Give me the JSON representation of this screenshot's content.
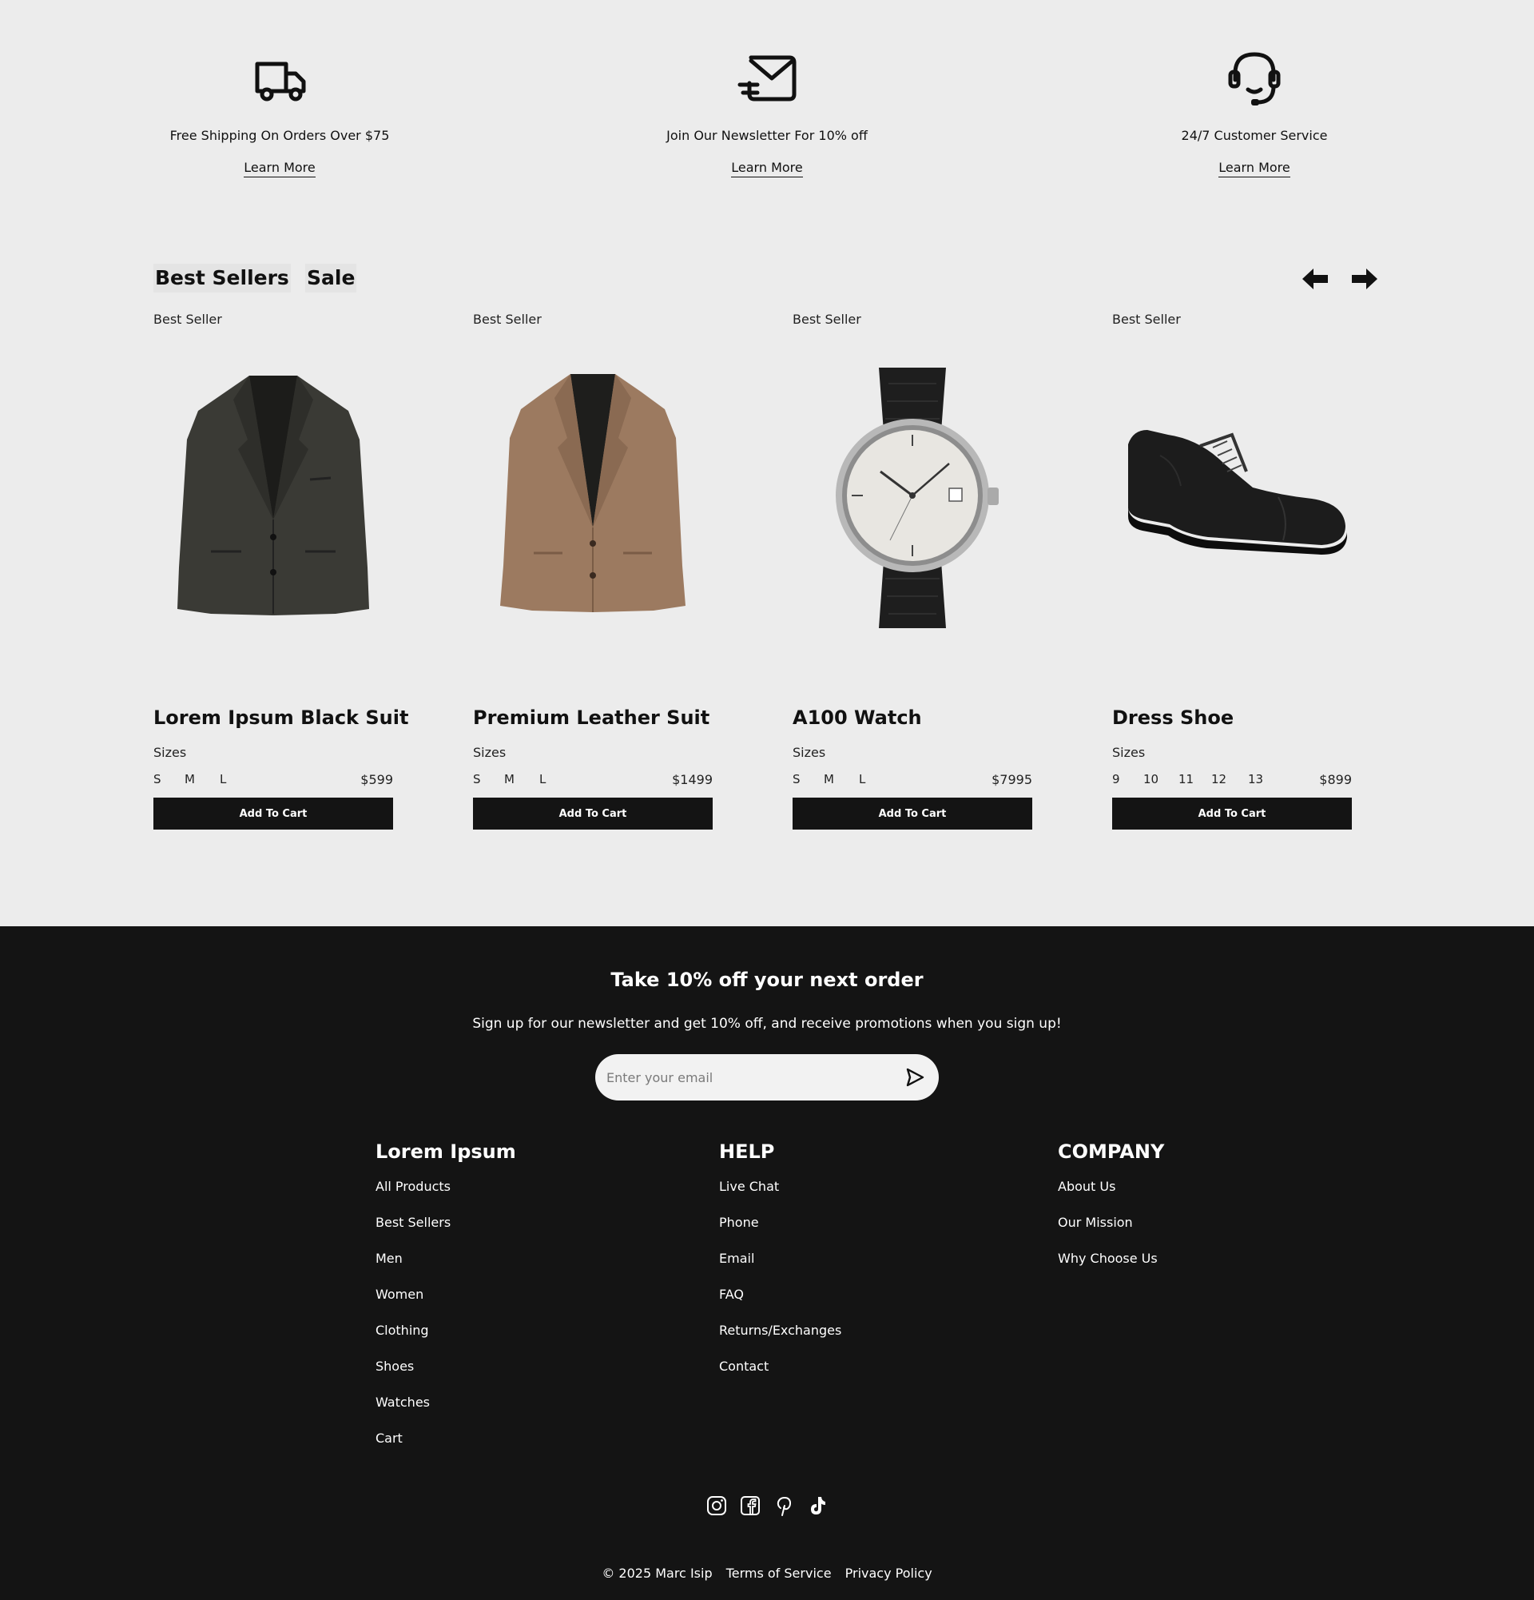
{
  "features": [
    {
      "icon": "truck-icon",
      "text": "Free Shipping On Orders Over $75",
      "link": "Learn More"
    },
    {
      "icon": "mail-icon",
      "text": "Join Our Newsletter For 10% off",
      "link": "Learn More"
    },
    {
      "icon": "headset-icon",
      "text": "24/7 Customer Service",
      "link": "Learn More"
    }
  ],
  "products_section": {
    "tabs": [
      "Best Sellers",
      "Sale"
    ],
    "prev_icon": "arrow-left-icon",
    "next_icon": "arrow-right-icon"
  },
  "products": [
    {
      "badge": "Best Seller",
      "image": "black-suit",
      "name": "Lorem Ipsum Black Suit",
      "sizes_label": "Sizes",
      "sizes": [
        "S",
        "M",
        "L"
      ],
      "price": "$599",
      "button": "Add To Cart"
    },
    {
      "badge": "Best Seller",
      "image": "tan-suit",
      "name": "Premium Leather Suit",
      "sizes_label": "Sizes",
      "sizes": [
        "S",
        "M",
        "L"
      ],
      "price": "$1499",
      "button": "Add To Cart"
    },
    {
      "badge": "Best Seller",
      "image": "watch",
      "name": "A100 Watch",
      "sizes_label": "Sizes",
      "sizes": [
        "S",
        "M",
        "L"
      ],
      "price": "$7995",
      "button": "Add To Cart"
    },
    {
      "badge": "Best Seller",
      "image": "dress-shoe",
      "name": "Dress Shoe",
      "sizes_label": "Sizes",
      "sizes": [
        "9",
        "10",
        "11",
        "12",
        "13"
      ],
      "price": "$899",
      "button": "Add To Cart"
    }
  ],
  "footer": {
    "newsletter": {
      "title": "Take 10% off your next order",
      "subtitle": "Sign up for our newsletter and get 10% off, and receive promotions when you sign up!",
      "placeholder": "Enter your email",
      "send_icon": "send-icon"
    },
    "columns": [
      {
        "title": "Lorem Ipsum",
        "links": [
          "All Products",
          "Best Sellers",
          "Men",
          "Women",
          "Clothing",
          "Shoes",
          "Watches",
          "Cart"
        ]
      },
      {
        "title": "HELP",
        "links": [
          "Live Chat",
          "Phone",
          "Email",
          "FAQ",
          "Returns/Exchanges",
          "Contact"
        ]
      },
      {
        "title": "COMPANY",
        "links": [
          "About Us",
          "Our Mission",
          "Why Choose Us"
        ]
      }
    ],
    "social": [
      "instagram-icon",
      "facebook-icon",
      "pinterest-icon",
      "tiktok-icon"
    ],
    "copyright": "© 2025 Marc Isip",
    "legal_links": [
      "Terms of Service",
      "Privacy Policy"
    ]
  },
  "colors": {
    "page_background": "#ececec",
    "footer_background": "#141414",
    "button_background": "#141414",
    "text": "#111111"
  }
}
